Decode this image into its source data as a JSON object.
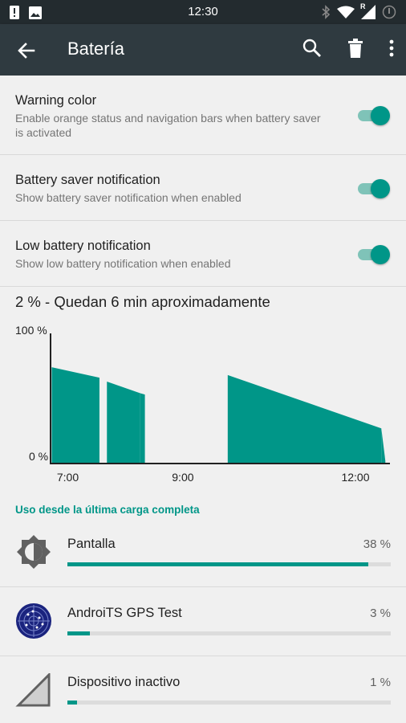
{
  "status_bar": {
    "time": "12:30",
    "left_icons": [
      "alert-icon",
      "image-icon"
    ],
    "right_icons": [
      "bluetooth-icon",
      "wifi-icon",
      "signal-r-icon",
      "battery-alert-icon"
    ],
    "roaming_label": "R"
  },
  "app_bar": {
    "title": "Batería",
    "actions": [
      "search-icon",
      "delete-icon",
      "more-icon"
    ]
  },
  "settings": [
    {
      "title": "Warning color",
      "summary": "Enable orange status and navigation bars when battery saver is activated",
      "enabled": true
    },
    {
      "title": "Battery saver notification",
      "summary": "Show battery saver notification when enabled",
      "enabled": true
    },
    {
      "title": "Low battery notification",
      "summary": "Show low battery notification when enabled",
      "enabled": true
    }
  ],
  "battery_summary": "2 % - Quedan 6 min aproximadamente",
  "chart_data": {
    "type": "area",
    "y_max_label": "100 %",
    "y_min_label": "0 %",
    "ylim": [
      0,
      100
    ],
    "x_tick_labels": [
      "7:00",
      "9:00",
      "12:00"
    ],
    "x_ticks_hours": [
      7,
      9,
      12
    ],
    "xlim_hours": [
      6.7,
      12.6
    ],
    "color": "#009688",
    "segments": [
      {
        "x": [
          6.72,
          7.55
        ],
        "y": [
          74,
          66
        ]
      },
      {
        "x": [
          7.68,
          8.26
        ],
        "y": [
          63,
          54
        ]
      },
      {
        "x": [
          8.26,
          8.34
        ],
        "y": [
          54,
          53
        ]
      },
      {
        "x": [
          9.78,
          12.45
        ],
        "y": [
          68,
          27
        ]
      },
      {
        "x": [
          12.45,
          12.52
        ],
        "y": [
          27,
          2
        ]
      }
    ]
  },
  "usage_header": "Uso desde la última carga completa",
  "apps": [
    {
      "name": "Pantalla",
      "percent_label": "38 %",
      "fill_fraction": 0.93,
      "icon": "brightness-icon"
    },
    {
      "name": "AndroiTS GPS Test",
      "percent_label": "3 %",
      "fill_fraction": 0.07,
      "icon": "gps-app-icon"
    },
    {
      "name": "Dispositivo inactivo",
      "percent_label": "1 %",
      "fill_fraction": 0.03,
      "icon": "cell-signal-icon"
    }
  ]
}
